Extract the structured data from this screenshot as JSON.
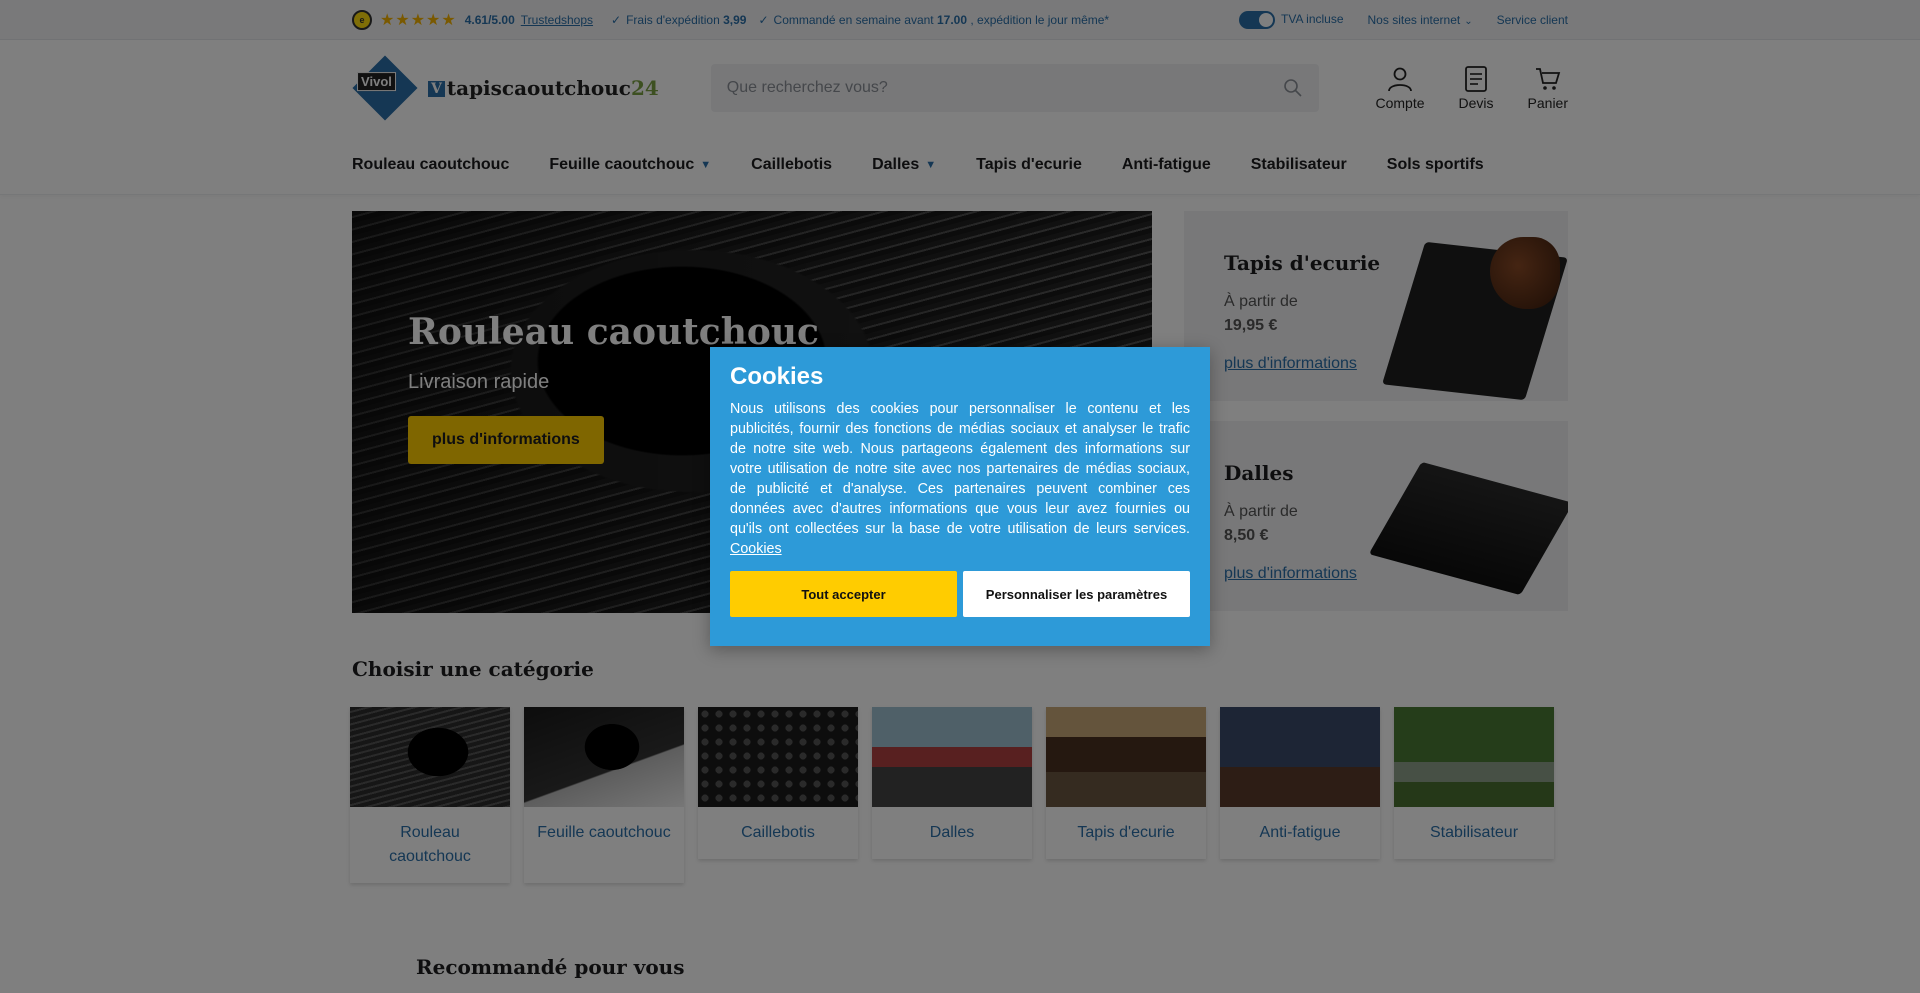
{
  "topbar": {
    "ts_badge": "e",
    "stars": "★★★★★",
    "rating": "4.61/5.00",
    "trustedshops": "Trustedshops",
    "usp1_text": "Frais d'expédition",
    "usp1_value": "3,99",
    "usp2_text": "Commandé en semaine avant",
    "usp2_value": "17.00",
    "usp2_suffix": ", expédition le jour même*",
    "vat_label": "TVA incluse",
    "sites_label": "Nos sites internet",
    "service_label": "Service client"
  },
  "header": {
    "logo_vivol": "Vivol",
    "logo_v": "V",
    "logo_text": "tapiscaoutchouc",
    "logo_num": "24",
    "search_placeholder": "Que recherchez vous?",
    "account": "Compte",
    "quote": "Devis",
    "cart": "Panier"
  },
  "nav": [
    {
      "label": "Rouleau caoutchouc",
      "dropdown": false
    },
    {
      "label": "Feuille caoutchouc",
      "dropdown": true
    },
    {
      "label": "Caillebotis",
      "dropdown": false
    },
    {
      "label": "Dalles",
      "dropdown": true
    },
    {
      "label": "Tapis d'ecurie",
      "dropdown": false
    },
    {
      "label": "Anti-fatigue",
      "dropdown": false
    },
    {
      "label": "Stabilisateur",
      "dropdown": false
    },
    {
      "label": "Sols sportifs",
      "dropdown": false
    }
  ],
  "hero": {
    "title": "Rouleau caoutchouc",
    "subtitle": "Livraison rapide",
    "button": "plus d'informations"
  },
  "side_cards": [
    {
      "title": "Tapis d'ecurie",
      "from": "À partir de",
      "price": "19,95 €",
      "link": "plus d'informations"
    },
    {
      "title": "Dalles",
      "from": "À partir de",
      "price": "8,50 €",
      "link": "plus d'informations"
    }
  ],
  "categories": {
    "title": "Choisir une catégorie",
    "items": [
      {
        "label": "Rouleau caoutchouc"
      },
      {
        "label": "Feuille caoutchouc"
      },
      {
        "label": "Caillebotis"
      },
      {
        "label": "Dalles"
      },
      {
        "label": "Tapis d'ecurie"
      },
      {
        "label": "Anti-fatigue"
      },
      {
        "label": "Stabilisateur"
      }
    ]
  },
  "recommended_title": "Recommandé pour vous",
  "cookie": {
    "title": "Cookies",
    "text": "Nous utilisons des cookies pour personnaliser le contenu et les publicités, fournir des fonctions de médias sociaux et analyser le trafic de notre site web. Nous partageons également des informations sur votre utilisation de notre site avec nos partenaires de médias sociaux, de publicité et d'analyse. Ces partenaires peuvent combiner ces données avec d'autres informations que vous leur avez fournies ou qu'ils ont collectées sur la base de votre utilisation de leurs services.",
    "link": "Cookies",
    "accept": "Tout accepter",
    "customize": "Personnaliser les paramètres"
  },
  "colors": {
    "accent": "#2a6fa8",
    "button_yellow": "#ffcc00",
    "cookie_bg": "#2d9ad8"
  }
}
